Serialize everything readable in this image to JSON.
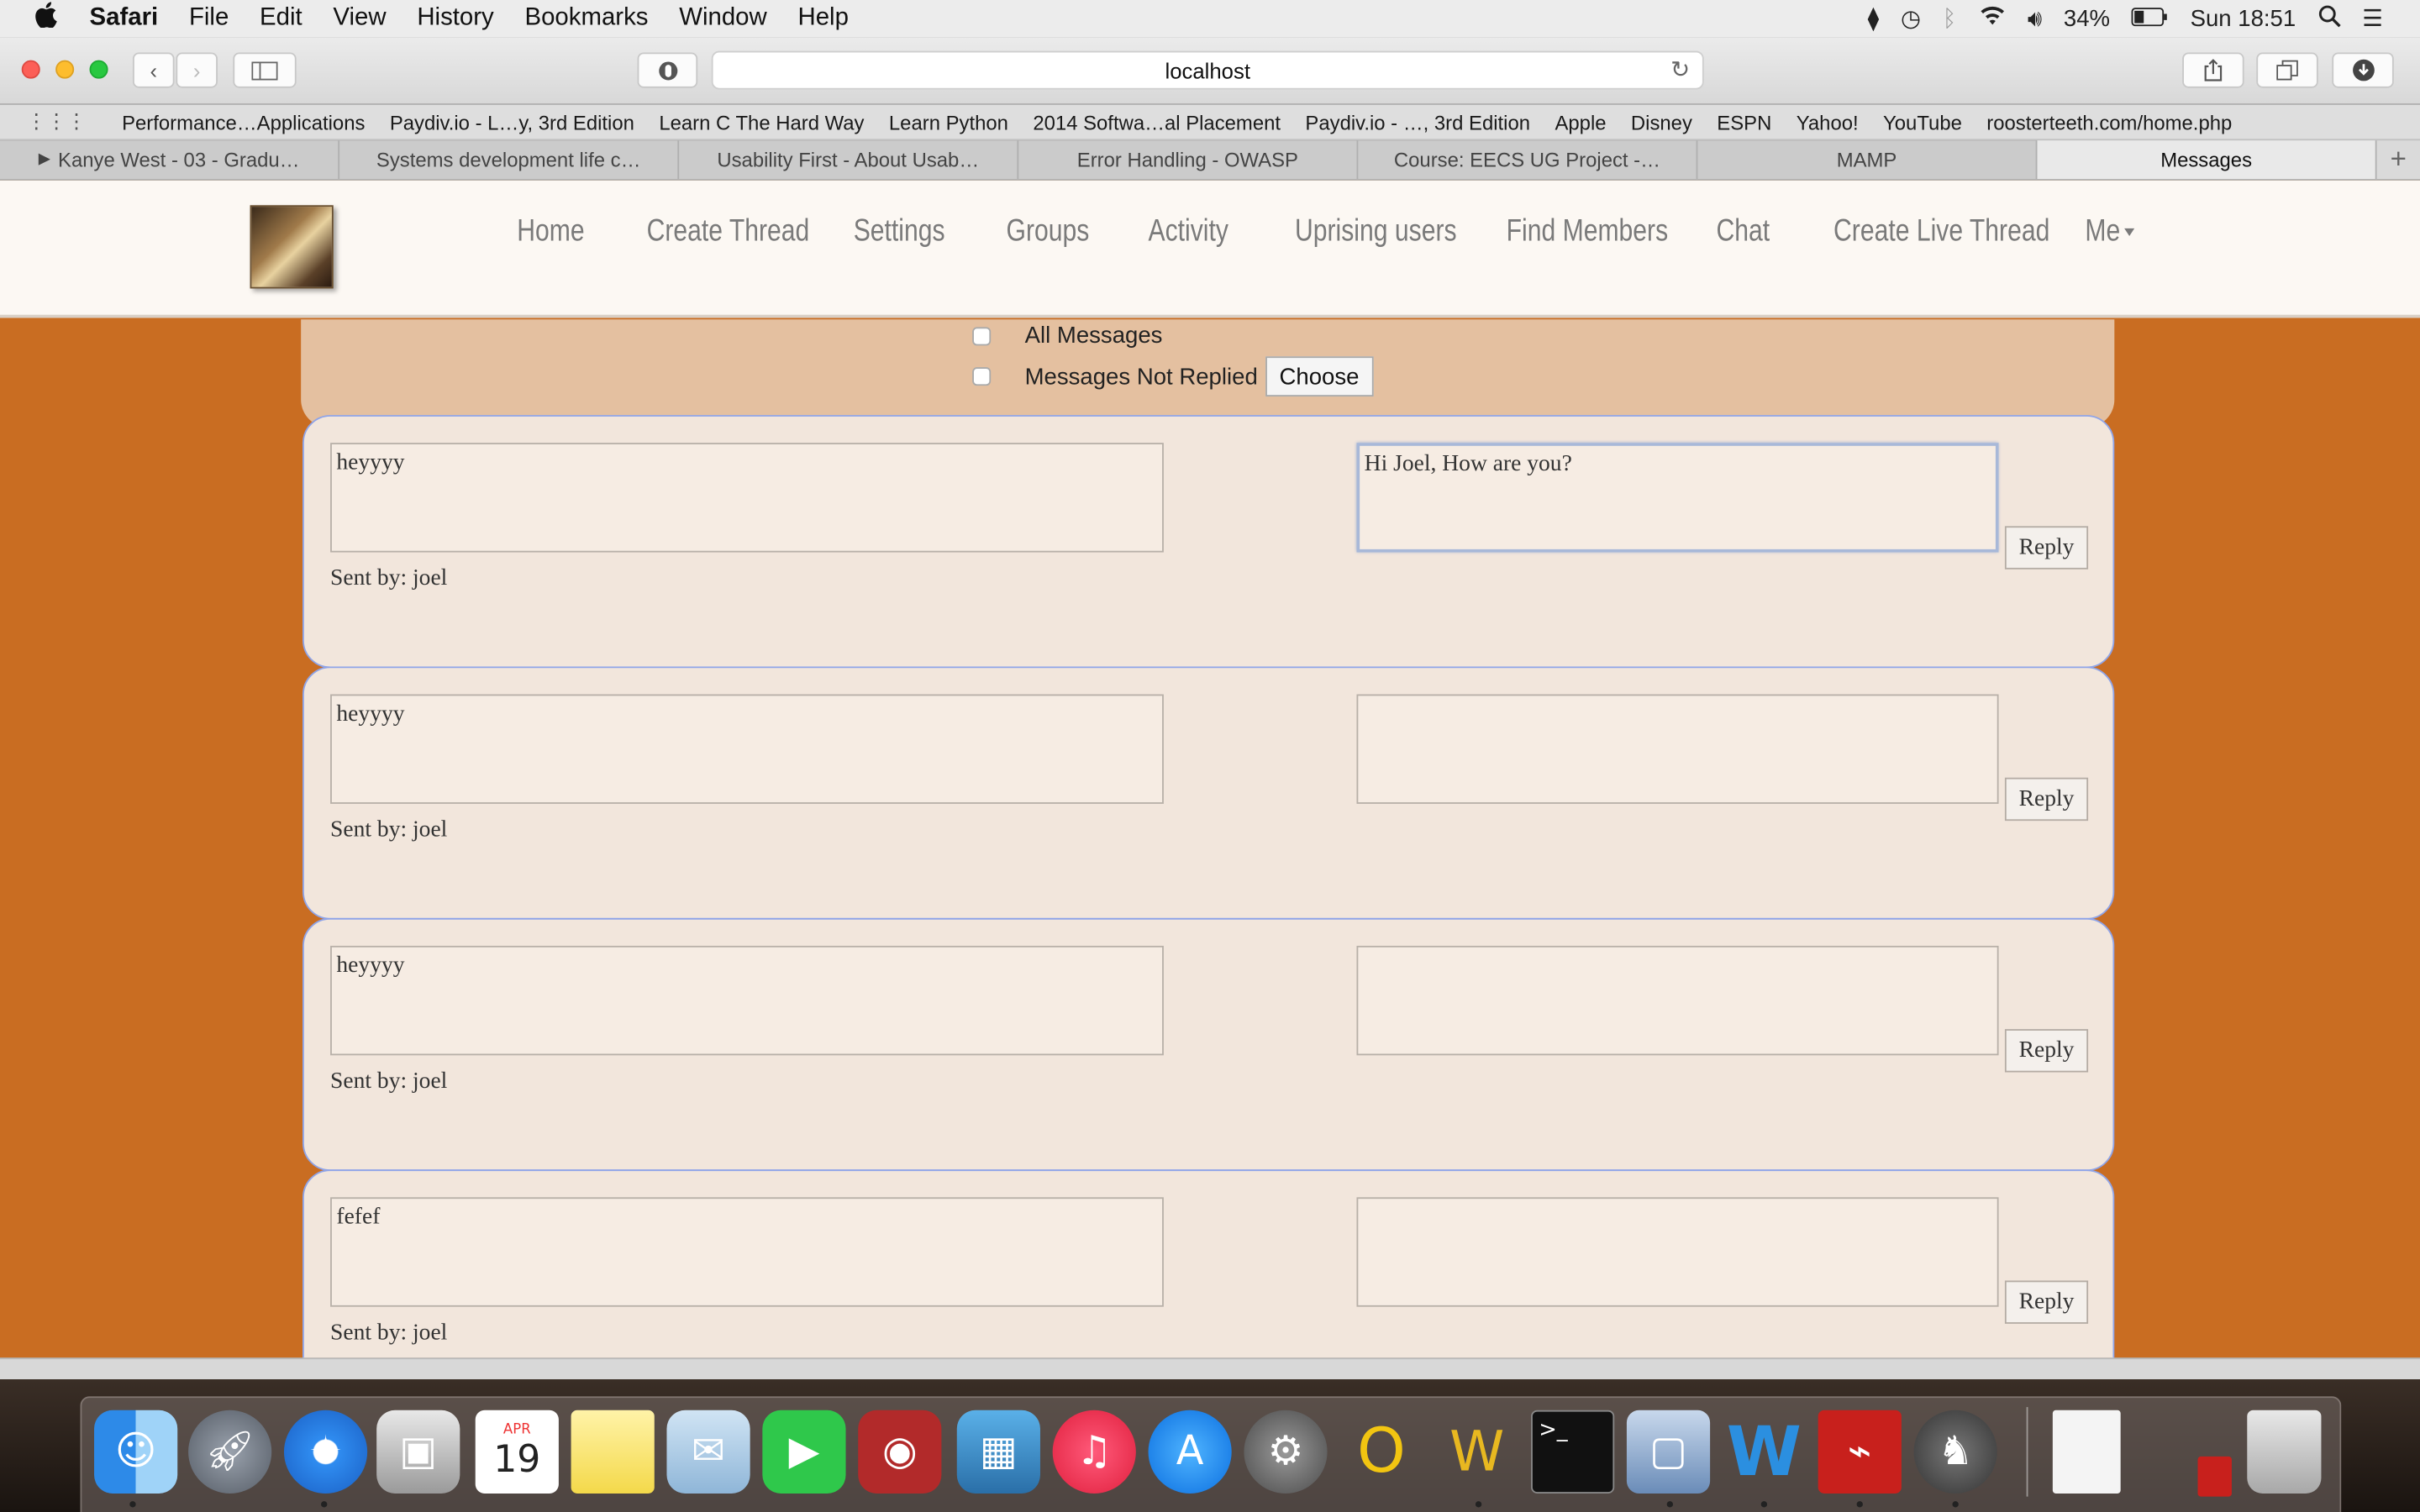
{
  "menubar": {
    "apple": "",
    "app_name": "Safari",
    "menus": [
      "File",
      "Edit",
      "View",
      "History",
      "Bookmarks",
      "Window",
      "Help"
    ],
    "battery": "34%",
    "clock": "Sun 18:51"
  },
  "browser": {
    "url": "localhost",
    "favorites": [
      "Performance…Applications",
      "Paydiv.io - L…y, 3rd Edition",
      "Learn C The Hard Way",
      "Learn Python",
      "2014 Softwa…al Placement",
      "Paydiv.io - …, 3rd Edition",
      "Apple",
      "Disney",
      "ESPN",
      "Yahoo!",
      "YouTube",
      "roosterteeth.com/home.php"
    ],
    "tabs": [
      {
        "label": "Kanye West - 03 - Gradu…"
      },
      {
        "label": "Systems development life c…"
      },
      {
        "label": "Usability First - About Usab…"
      },
      {
        "label": "Error Handling - OWASP"
      },
      {
        "label": "Course: EECS UG Project -…"
      },
      {
        "label": "MAMP"
      },
      {
        "label": "Messages"
      }
    ]
  },
  "site_nav": {
    "links": [
      "Home",
      "Create Thread",
      "Settings",
      "Groups",
      "Activity",
      "Uprising users",
      "Find Members",
      "Chat",
      "Create Live Thread",
      "Me"
    ]
  },
  "filter": {
    "all_messages": "All Messages",
    "not_replied": "Messages Not Replied",
    "choose": "Choose"
  },
  "messages": [
    {
      "text": "heyyyy",
      "sent_by": "Sent by: joel",
      "reply": "Hi Joel, How are you?",
      "reply_label": "Reply"
    },
    {
      "text": "heyyyy",
      "sent_by": "Sent by: joel",
      "reply": "",
      "reply_label": "Reply"
    },
    {
      "text": "heyyyy",
      "sent_by": "Sent by: joel",
      "reply": "",
      "reply_label": "Reply"
    },
    {
      "text": "fefef",
      "sent_by": "Sent by: joel",
      "reply": "",
      "reply_label": "Reply"
    }
  ],
  "dock": {
    "calendar_month": "APR",
    "calendar_day": "19",
    "icons": [
      "finder-icon",
      "launchpad-icon",
      "safari-icon",
      "preview-icon",
      "calendar-icon",
      "notes-icon",
      "mail-icon",
      "facetime-icon",
      "photo-booth-icon",
      "iphoto-icon",
      "itunes-icon",
      "app-store-icon",
      "system-preferences-icon",
      "opera-icon",
      "winrar-icon",
      "terminal-icon",
      "virtualbox-icon",
      "word-icon",
      "acrobat-icon",
      "mamp-icon",
      "document-icon",
      "pdf-icon",
      "trash-icon"
    ]
  }
}
